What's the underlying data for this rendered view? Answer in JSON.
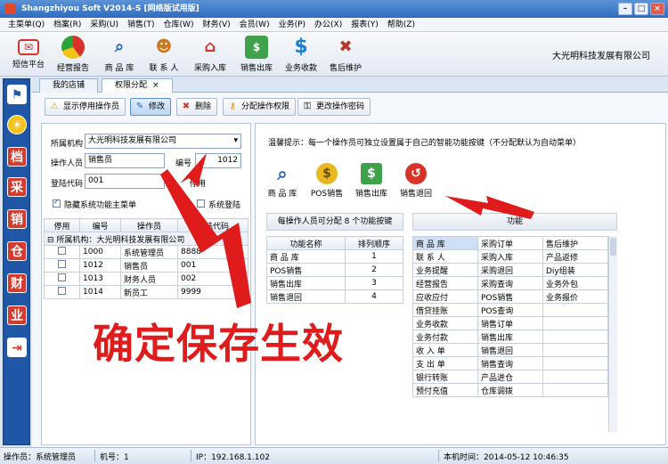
{
  "window": {
    "title": "Shangzhiyou Soft V2014-S [网络版试用版]"
  },
  "menu": [
    "主菜单(Q)",
    "档案(R)",
    "采购(U)",
    "销售(T)",
    "仓库(W)",
    "财务(V)",
    "会员(W)",
    "业务(P)",
    "办公(X)",
    "报表(Y)",
    "帮助(Z)"
  ],
  "toolbar": {
    "items": [
      {
        "label": "短信平台",
        "icon": "envelope-icon",
        "color": "#d8332a"
      },
      {
        "label": "经营报告",
        "icon": "pie-chart-icon",
        "color": "#2aa33a"
      },
      {
        "label": "商 品 库",
        "icon": "magnifier-icon",
        "color": "#2266bb"
      },
      {
        "label": "联 系 人",
        "icon": "person-icon",
        "color": "#c87a22"
      },
      {
        "label": "采购入库",
        "icon": "house-icon",
        "color": "#d8332a"
      },
      {
        "label": "销售出库",
        "icon": "money-icon",
        "color": "#2a8a3a"
      },
      {
        "label": "业务收款",
        "icon": "dollar-icon",
        "color": "#1a7fd0"
      },
      {
        "label": "售后维护",
        "icon": "tools-icon",
        "color": "#b33a2a"
      }
    ],
    "company": "大光明科技发展有限公司"
  },
  "tabs": [
    "我的店铺",
    "权限分配"
  ],
  "actions": {
    "show_disabled": "显示停用操作员",
    "edit": "修改",
    "delete": "删除",
    "assign": "分配操作权限",
    "change_pwd": "更改操作密码"
  },
  "form": {
    "org_label": "所属机构",
    "org_value": "大光明科技发展有限公司",
    "operator_label": "操作人员",
    "operator_value": "销售员",
    "no_label": "编号",
    "no_value": "1012",
    "login_label": "登陆代码",
    "login_value": "001",
    "disable_label": "停用",
    "hide_menu_label": "隐藏系统功能主菜单",
    "sys_login_label": "系统登陆"
  },
  "op_table": {
    "headers": [
      "停用",
      "编号",
      "操作员",
      "登陆代码"
    ],
    "group_label": "所属机构：大光明科技发展有限公司",
    "rows": [
      {
        "no": "1000",
        "name": "系统管理员",
        "code": "8888"
      },
      {
        "no": "1012",
        "name": "销售员",
        "code": "001"
      },
      {
        "no": "1013",
        "name": "财务人员",
        "code": "002"
      },
      {
        "no": "1014",
        "name": "新员工",
        "code": "9999"
      }
    ]
  },
  "hint": "温馨提示：每一个操作员可独立设置属于自己的智能功能按键（不分配默认为自动菜单）",
  "func_icons": [
    {
      "label": "商 品 库",
      "icon": "magnifier-icon",
      "color": "#2266bb"
    },
    {
      "label": "POS销售",
      "icon": "coins-icon",
      "color": "#d4a11a"
    },
    {
      "label": "销售出库",
      "icon": "money-icon",
      "color": "#2a8a3a"
    },
    {
      "label": "销售退回",
      "icon": "return-icon",
      "color": "#d8332a"
    }
  ],
  "assign_table": {
    "caption": "每操作人员可分配 8 个功能按键",
    "headers": [
      "功能名称",
      "排列顺序"
    ],
    "rows": [
      {
        "name": "商 品 库",
        "order": "1"
      },
      {
        "name": "POS销售",
        "order": "2"
      },
      {
        "name": "销售出库",
        "order": "3"
      },
      {
        "name": "销售退回",
        "order": "4"
      }
    ]
  },
  "func_list": {
    "caption_partial": "功能",
    "rows": [
      [
        "商 品 库",
        "采购订单",
        "售后维护"
      ],
      [
        "联 系 人",
        "采购入库",
        "产品返修"
      ],
      [
        "业务提醒",
        "采购退回",
        "Diy组装"
      ],
      [
        "经营报告",
        "采购查询",
        "业务外包"
      ],
      [
        "应收应付",
        "POS销售",
        "业务报价"
      ],
      [
        "借贷挂账",
        "POS查询",
        ""
      ],
      [
        "业务收款",
        "销售订单",
        ""
      ],
      [
        "业务付款",
        "销售出库",
        ""
      ],
      [
        "收 入 单",
        "销售退回",
        ""
      ],
      [
        "支 出 单",
        "销售查询",
        ""
      ],
      [
        "银行转账",
        "产品进仓",
        ""
      ],
      [
        "预付充值",
        "仓库调拨",
        ""
      ]
    ]
  },
  "overlay_text": "确定保存生效",
  "status": {
    "operator": "操作员：系统管理员",
    "machine": "机号：1",
    "ip": "IP：192.168.1.102",
    "time": "本机时间：2014-05-12 10:46:35"
  },
  "colors": {
    "accent": "#e01b1b",
    "leftbar": "#1f56a6"
  }
}
